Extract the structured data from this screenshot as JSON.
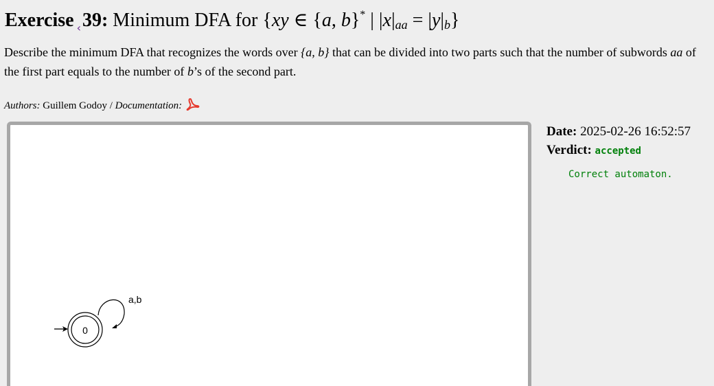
{
  "title": {
    "prefix": "Exercise",
    "back_glyph": "‹",
    "number": "39:",
    "name": "Minimum DFA for",
    "formula": {
      "set_open": "{",
      "xy": "xy",
      "in": " ∈ {",
      "a": "a",
      "comma": ", ",
      "b": "b",
      "close_star": "}",
      "star": "*",
      "bar": " | |",
      "x": "x",
      "bar2": "|",
      "sub_aa": "aa",
      "eq": " = |",
      "y": "y",
      "bar3": "|",
      "sub_b": "b",
      "set_close": "}"
    }
  },
  "description": {
    "part1": "Describe the minimum DFA that recognizes the words over ",
    "set": "{a, b}",
    "part2": " that can be divided into two parts such that the number of subwords ",
    "aa": "aa",
    "part3": " of the first part equals to the number of ",
    "b": "b",
    "part4": "’s of the second part."
  },
  "authors": {
    "label": "Authors:",
    "names": " Guillem Godoy / ",
    "doc_label": "Documentation:",
    "doc_icon": "pdf-icon",
    "doc_icon_color": "#e53a2e"
  },
  "automaton": {
    "state_label": "0",
    "loop_label": "a,b"
  },
  "submission": {
    "date_label": "Date:",
    "date_value": " 2025-02-26 16:52:57",
    "verdict_label": "Verdict:",
    "verdict_value": "accepted",
    "result_message": "Correct automaton.",
    "verdict_color": "#00800a"
  }
}
